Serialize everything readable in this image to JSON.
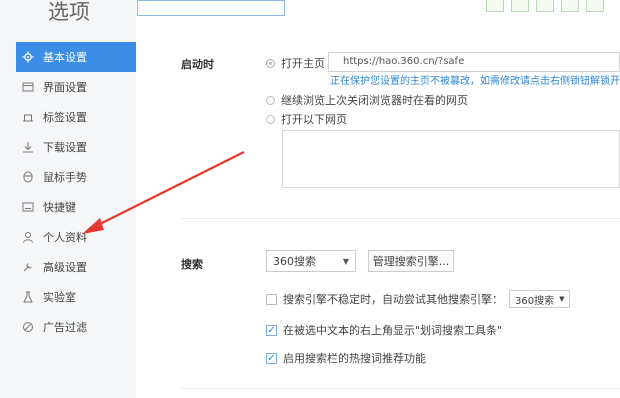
{
  "header": {
    "title": "选项"
  },
  "toolbar_icons": [
    "save-icon",
    "share-icon",
    "disk-icon",
    "export-icon",
    "settings-icon"
  ],
  "sidebar": {
    "items": [
      {
        "label": "基本设置",
        "icon": "gear-icon",
        "active": true
      },
      {
        "label": "界面设置",
        "icon": "window-icon"
      },
      {
        "label": "标签设置",
        "icon": "tab-icon"
      },
      {
        "label": "下载设置",
        "icon": "download-icon"
      },
      {
        "label": "鼠标手势",
        "icon": "mouse-icon"
      },
      {
        "label": "快捷键",
        "icon": "keyboard-icon"
      },
      {
        "label": "个人资料",
        "icon": "user-icon"
      },
      {
        "label": "高级设置",
        "icon": "tools-icon"
      },
      {
        "label": "实验室",
        "icon": "flask-icon"
      },
      {
        "label": "广告过滤",
        "icon": "block-icon"
      }
    ]
  },
  "startup": {
    "label": "启动时",
    "opt_homepage": "打开主页",
    "homepage_url": "https://hao.360.cn/?safe",
    "note": "正在保护您设置的主页不被篡改，如需修改请点击右侧锁钮解锁开",
    "opt_continue": "继续浏览上次关闭浏览器时在看的网页",
    "opt_pages": "打开以下网页"
  },
  "search": {
    "label": "搜索",
    "engine": "360搜索",
    "manage_button": "管理搜索引擎...",
    "unstable_text": "搜索引擎不稳定时，自动尝试其他搜索引擎：",
    "fallback_engine": "360搜索",
    "toolbar_text": "在被选中文本的右上角显示\"划词搜索工具条\"",
    "hot_words_text": "启用搜索栏的热搜词推荐功能"
  },
  "accent_color": "#3b8de6",
  "annotation_arrow_color": "#e53935"
}
